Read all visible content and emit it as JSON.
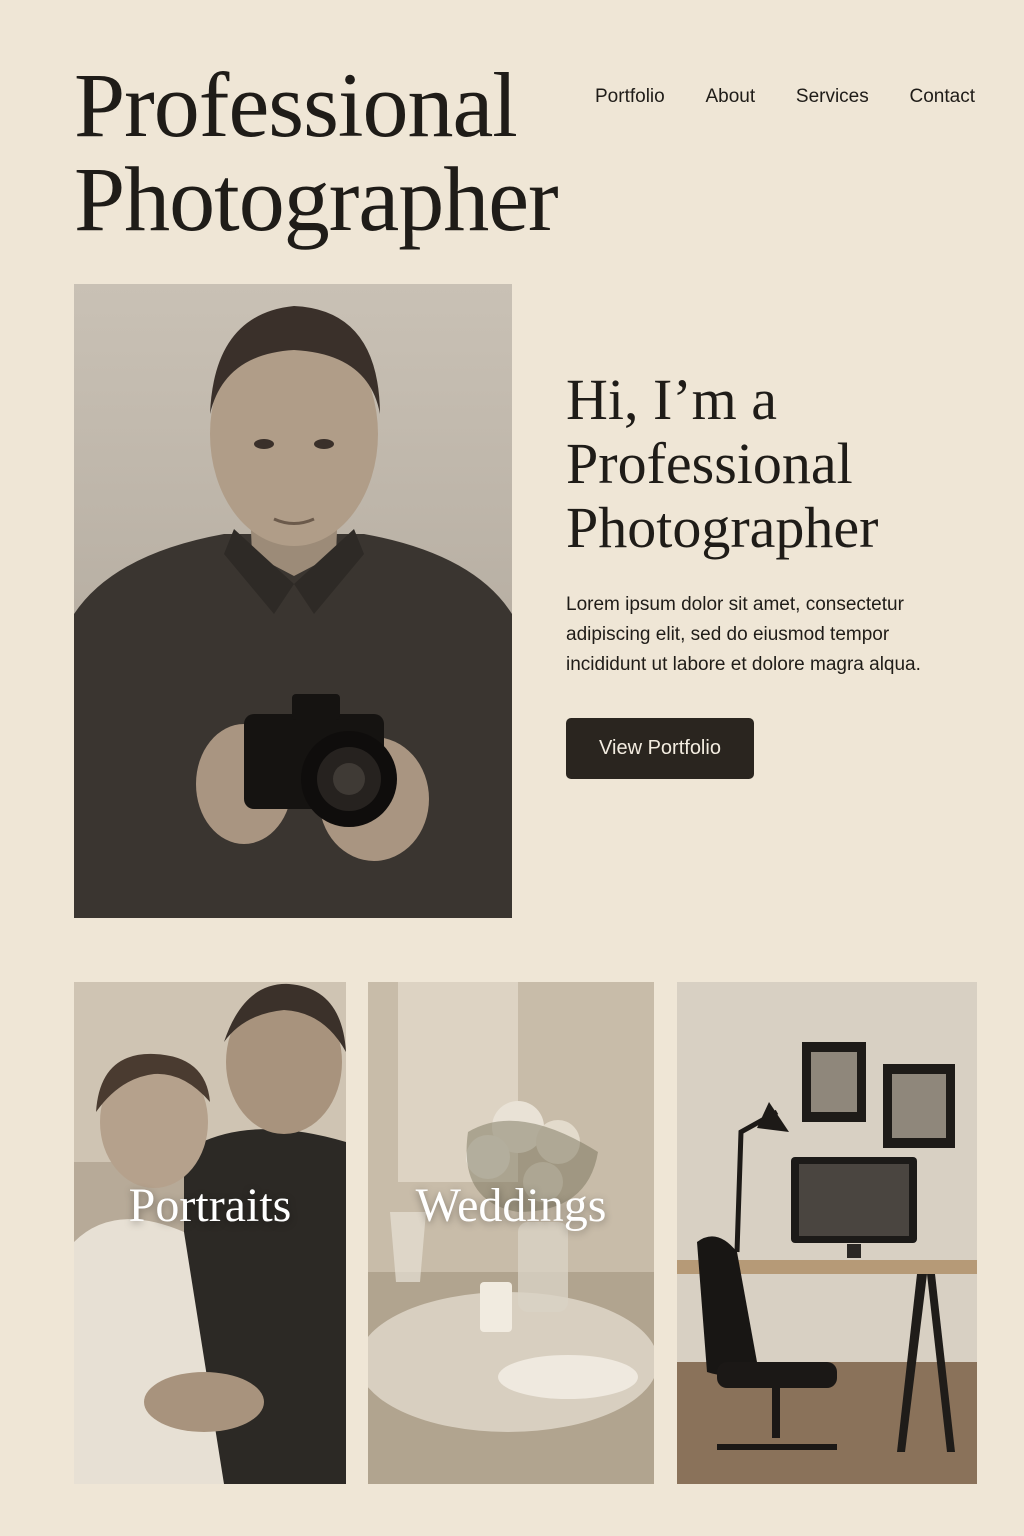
{
  "header": {
    "title_line1": "Professional",
    "title_line2": "Photographer",
    "nav": [
      "Portfolio",
      "About",
      "Services",
      "Contact"
    ]
  },
  "hero": {
    "heading_line1": "Hi, I’m a",
    "heading_line2": "Professional",
    "heading_line3": "Photographer",
    "text": "Lorem ipsum dolor sit amet, consectetur adipiscing elit, sed do eiusmod tempor incididunt ut labore et dolore magra alqua.",
    "cta_label": "View Portfolio"
  },
  "categories": [
    {
      "label": "Portraits"
    },
    {
      "label": "Weddings"
    },
    {
      "label": ""
    }
  ],
  "colors": {
    "background": "#efe6d6",
    "text": "#1f1c18",
    "button": "#2a251f"
  }
}
